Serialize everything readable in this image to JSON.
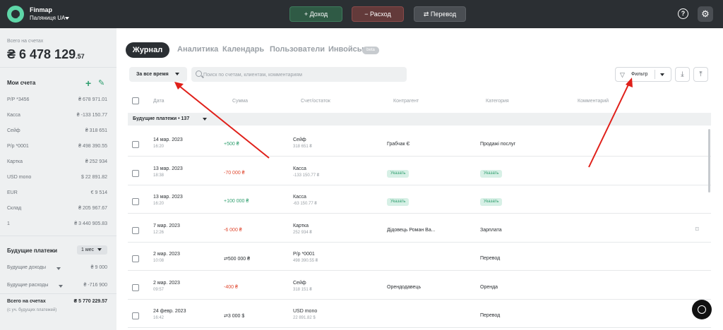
{
  "topbar": {
    "brand": "Finmap",
    "company": "Паляниця UA",
    "buttons": [
      {
        "label": "+ Доход"
      },
      {
        "label": "− Расход"
      },
      {
        "label": "⇄ Перевод"
      }
    ]
  },
  "sidebar": {
    "balance_label": "Всего на счетах",
    "balance_main": "₴ 6 478 129",
    "balance_cents": ".57",
    "accounts_title": "Мои счета",
    "accounts": [
      {
        "name": "P/P *3456",
        "value": "₴ 678 971.01"
      },
      {
        "name": "Касса",
        "value": "₴ -133 150.77"
      },
      {
        "name": "Сейф",
        "value": "₴ 318 651"
      },
      {
        "name": "Р/р *0001",
        "value": "₴ 498 390.55"
      },
      {
        "name": "Картка",
        "value": "₴ 252 934"
      },
      {
        "name": "USD mono",
        "value": "$ 22 891.82"
      },
      {
        "name": "EUR",
        "value": "€ 9 514"
      },
      {
        "name": "Склад",
        "value": "₴ 205 967.67"
      },
      {
        "name": "1",
        "value": "₴ 3 440 905.83"
      }
    ],
    "future_title": "Будущие платежи",
    "future_period": "1 мес",
    "future_income_label": "Будущие доходы",
    "future_income_value": "₴ 9 000",
    "future_expense_label": "Будущие расходы",
    "future_expense_value": "₴ -716 900",
    "total_label": "Всего на счетах",
    "total_note": "(с уч. будущих платежей)",
    "total_value": "₴ 5 770 229.57"
  },
  "tabs": [
    "Журнал",
    "Аналитика",
    "Календарь",
    "Пользователи",
    "Инвойсы"
  ],
  "beta": "beta",
  "toolbar": {
    "period": "За все время",
    "search_placeholder": "Поиск по счетам, клиентам, комментариям",
    "filter": "Фильтр"
  },
  "columns": [
    "Дата",
    "Сумма",
    "Счет/остаток",
    "Контрагент",
    "Категория",
    "Комментарий"
  ],
  "group": "Будущие платежи • 137",
  "rows": [
    {
      "date": "14 мар. 2023",
      "time": "16:20",
      "amount": "+500 ₴",
      "type": "pos",
      "account": "Сейф",
      "balance": "318 651 ₴",
      "counterparty": "Грабчак Є",
      "cp_pill": false,
      "category": "Продажі послуг",
      "cat_pill": false,
      "tag": false
    },
    {
      "date": "13 мар. 2023",
      "time": "18:38",
      "amount": "-70 000 ₴",
      "type": "neg",
      "account": "Касса",
      "balance": "-133 150.77 ₴",
      "counterparty": "Указать",
      "cp_pill": true,
      "category": "Указать",
      "cat_pill": true,
      "tag": false
    },
    {
      "date": "13 мар. 2023",
      "time": "16:20",
      "amount": "+100 000 ₴",
      "type": "pos",
      "account": "Касса",
      "balance": "-63 150.77 ₴",
      "counterparty": "Указать",
      "cp_pill": true,
      "category": "Указать",
      "cat_pill": true,
      "tag": false
    },
    {
      "date": "7 мар. 2023",
      "time": "12:26",
      "amount": "-6 000 ₴",
      "type": "neg",
      "account": "Картка",
      "balance": "252 934 ₴",
      "counterparty": "Дідовець Роман Ва...",
      "cp_pill": false,
      "category": "Зарплата",
      "cat_pill": false,
      "tag": true
    },
    {
      "date": "2 мар. 2023",
      "time": "10:08",
      "amount": "⇄500 000 ₴",
      "type": "plain",
      "account": "Р/р *0001",
      "balance": "498 390.55 ₴",
      "counterparty": "",
      "cp_pill": false,
      "category": "Перевод",
      "cat_pill": false,
      "tag": false
    },
    {
      "date": "2 мар. 2023",
      "time": "09:57",
      "amount": "-400 ₴",
      "type": "neg",
      "account": "Сейф",
      "balance": "318 151 ₴",
      "counterparty": "Орендодавець",
      "cp_pill": false,
      "category": "Оренда",
      "cat_pill": false,
      "tag": false
    },
    {
      "date": "24 февр. 2023",
      "time": "16:42",
      "amount": "⇄3 000 $",
      "type": "plain",
      "account": "USD mono",
      "balance": "22 891.82 $",
      "counterparty": "",
      "cp_pill": false,
      "category": "Перевод",
      "cat_pill": false,
      "tag": false
    }
  ],
  "colors": {
    "accent": "#2e9e6e",
    "negative": "#e04a32",
    "annotation": "#e0201a",
    "topbar": "#2b2f33"
  }
}
